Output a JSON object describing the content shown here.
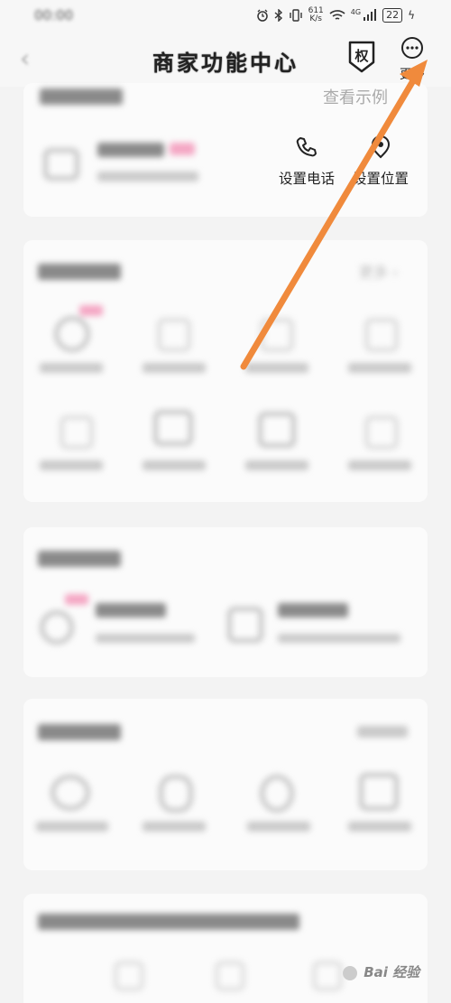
{
  "status_bar": {
    "time": "00:00",
    "net_speed_value": "611",
    "net_speed_unit": "K/s",
    "network": "4G",
    "battery": "22",
    "icons": [
      "alarm-icon",
      "bluetooth-icon",
      "vibrate-icon",
      "wifi-icon",
      "signal-icon",
      "battery-icon"
    ]
  },
  "header": {
    "title": "商家功能中心",
    "quan_badge": "权",
    "more_label": "更多"
  },
  "view_example": "查看示例",
  "actions": [
    {
      "label": "设置电话",
      "icon": "phone-icon"
    },
    {
      "label": "设置位置",
      "icon": "location-icon"
    }
  ],
  "section2": {
    "more_label": "更多 ›"
  },
  "arrow_color": "#f08a3c",
  "watermark": "Bai 经验"
}
